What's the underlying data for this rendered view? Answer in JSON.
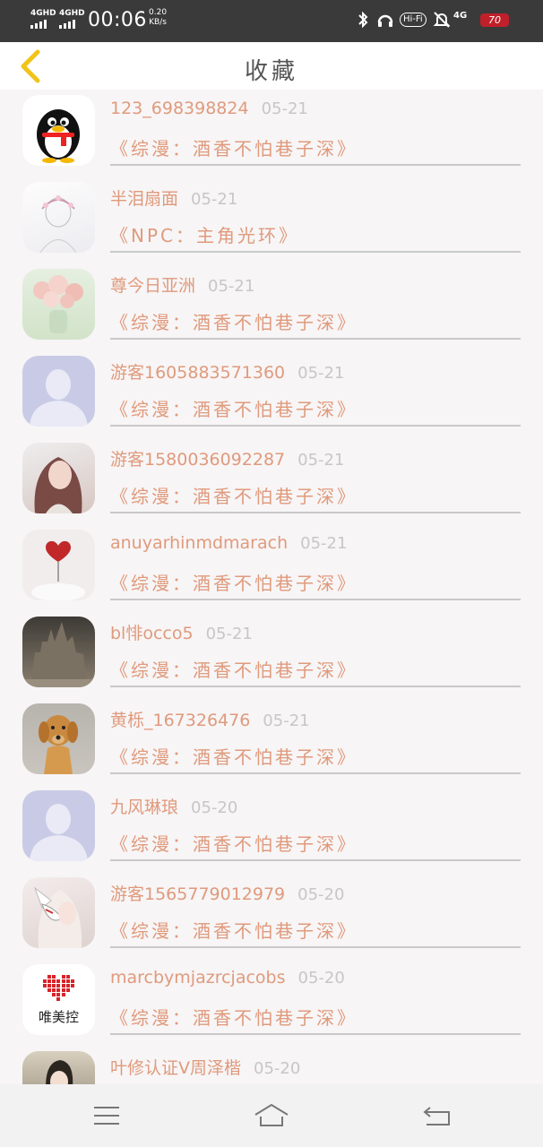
{
  "status_bar": {
    "net1": "4GHD",
    "net2": "4GHD",
    "time": "00:06",
    "speed_value": "0.20",
    "speed_unit": "KB/s",
    "hifi": "Hi-Fi",
    "net_type": "4G",
    "battery": "70"
  },
  "header": {
    "title": "收藏"
  },
  "items": [
    {
      "name": "123_698398824",
      "date": "05-21",
      "book": "《综漫：酒香不怕巷子深》",
      "avatar": "qq-penguin-avatar"
    },
    {
      "name": "半泪扇面",
      "date": "05-21",
      "book": "《NPC：主角光环》",
      "avatar": "sketch-girl-avatar"
    },
    {
      "name": "尊今日亚洲",
      "date": "05-21",
      "book": "《综漫：酒香不怕巷子深》",
      "avatar": "flowers-avatar"
    },
    {
      "name": "游客1605883571360",
      "date": "05-21",
      "book": "《综漫：酒香不怕巷子深》",
      "avatar": "default-user-avatar"
    },
    {
      "name": "游客1580036092287",
      "date": "05-21",
      "book": "《综漫：酒香不怕巷子深》",
      "avatar": "girl-photo-avatar"
    },
    {
      "name": "anuyarhinmdmarach",
      "date": "05-21",
      "book": "《综漫：酒香不怕巷子深》",
      "avatar": "heart-avatar"
    },
    {
      "name": "bl悱occo5",
      "date": "05-21",
      "book": "《综漫：酒香不怕巷子深》",
      "avatar": "castle-avatar"
    },
    {
      "name": "黄栎_167326476",
      "date": "05-21",
      "book": "《综漫：酒香不怕巷子深》",
      "avatar": "dog-avatar"
    },
    {
      "name": "九风琳琅",
      "date": "05-20",
      "book": "《综漫：酒香不怕巷子深》",
      "avatar": "default-user-avatar"
    },
    {
      "name": "游客1565779012979",
      "date": "05-20",
      "book": "《综漫：酒香不怕巷子深》",
      "avatar": "anime-fox-mask-avatar"
    },
    {
      "name": "marcbymjazrcjacobs",
      "date": "05-20",
      "book": "《综漫：酒香不怕巷子深》",
      "avatar": "weimeikong-logo-avatar",
      "avatar_text": "唯美控"
    },
    {
      "name": "叶修认证V周泽楷",
      "date": "05-20",
      "book": "",
      "avatar": "anime-boy-avatar"
    }
  ],
  "nav": {
    "icons": [
      "menu-icon",
      "home-icon",
      "back-icon"
    ]
  },
  "colors": {
    "accent_text": "#e09a7c",
    "date_text": "#c7c7c7",
    "back_arrow": "#f0c419",
    "status_bg": "#3a3a3a"
  }
}
